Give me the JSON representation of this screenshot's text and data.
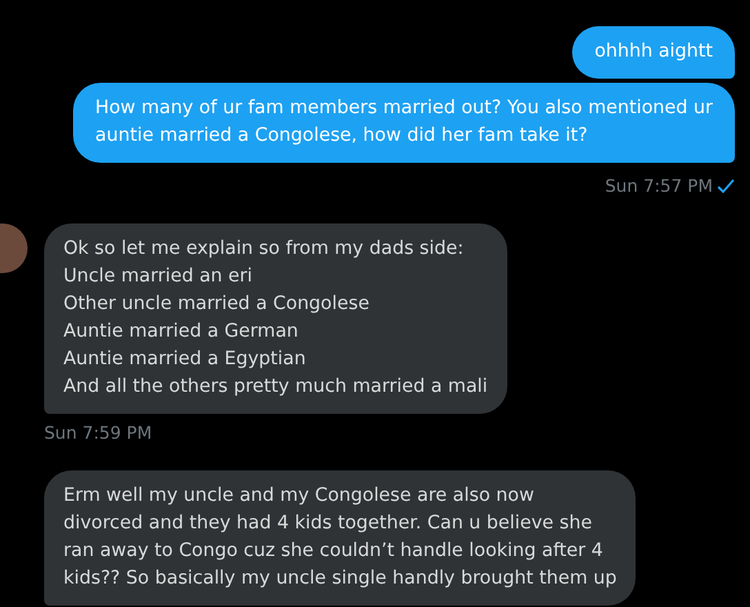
{
  "messages": [
    {
      "kind": "sent",
      "lines": [
        "ohhhh aightt"
      ]
    },
    {
      "kind": "sent",
      "lines": [
        "How many of ur fam members married out? You also mentioned ur",
        "auntie married a Congolese, how did her fam take it?"
      ],
      "timestamp": "Sun 7:57 PM",
      "read": true
    },
    {
      "kind": "received",
      "avatar": true,
      "lines": [
        "Ok so let me explain so from my dads side:",
        "Uncle married an eri",
        "Other uncle married a Congolese",
        "Auntie married a German",
        "Auntie married a Egyptian",
        "And all the others pretty much married a mali"
      ],
      "timestamp": "Sun 7:59 PM"
    },
    {
      "kind": "received",
      "avatar": false,
      "lines": [
        "Erm well my uncle and my Congolese are also now",
        "divorced and they had 4 kids together. Can u believe she",
        "ran away to Congo cuz she couldn’t handle looking after 4",
        "kids?? So basically my uncle single handly brought them up"
      ]
    }
  ]
}
